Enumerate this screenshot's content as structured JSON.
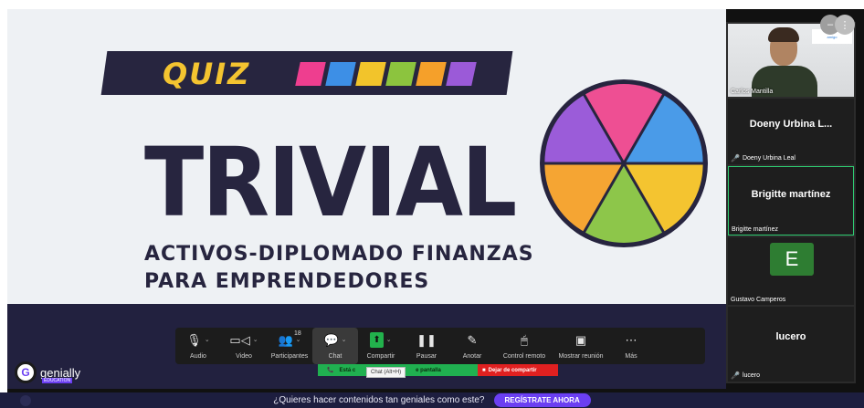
{
  "slide": {
    "quiz": "QUIZ",
    "trivial": "TRIVIAL",
    "subtitle_line1": "ACTIVOS-DIPLOMADO FINANZAS",
    "subtitle_line2": "PARA EMPRENDEDORES",
    "swatch_colors": [
      "#ee3e8f",
      "#3d8fe6",
      "#f2c42b",
      "#8cc43e",
      "#f5a02a",
      "#9b5ad8"
    ],
    "wheel_colors": [
      "#ee4f93",
      "#4a9be8",
      "#f4c430",
      "#8dc64a",
      "#f5a533",
      "#9b5cd9"
    ],
    "brand": "genially",
    "brand_sub": "EDUCATION"
  },
  "toolbar": {
    "items": [
      {
        "label": "Audio",
        "icon": "microphone-icon",
        "glyph": "🎙",
        "caret": true
      },
      {
        "label": "Video",
        "icon": "video-camera-icon",
        "glyph": "▭◁",
        "caret": true
      },
      {
        "label": "Participantes",
        "icon": "participants-icon",
        "glyph": "👥",
        "caret": true,
        "badge": "18"
      },
      {
        "label": "Chat",
        "icon": "chat-icon",
        "glyph": "💬",
        "caret": true,
        "active": true
      },
      {
        "label": "Compartir",
        "icon": "share-screen-icon",
        "glyph": "⬆",
        "caret": true
      },
      {
        "label": "Pausar",
        "icon": "pause-icon",
        "glyph": "❚❚",
        "caret": false
      },
      {
        "label": "Anotar",
        "icon": "annotate-pen-icon",
        "glyph": "✎",
        "caret": false
      },
      {
        "label": "Control remoto",
        "icon": "remote-control-mouse-icon",
        "glyph": "🖱",
        "caret": false
      },
      {
        "label": "Mostrar reunión",
        "icon": "show-meeting-icon",
        "glyph": "▣",
        "caret": false
      },
      {
        "label": "Más",
        "icon": "more-icon",
        "glyph": "⋯",
        "caret": false
      }
    ],
    "chat_tooltip": "Chat (Alt+H)",
    "share_status_left": "Está c",
    "share_status_right": "e pantalla",
    "stop_share": "Dejar de compartir"
  },
  "gallery": {
    "camera_name": "Carlos Mantilla",
    "poster_text": "amigo",
    "tiles": [
      {
        "big": "Doeny Urbina L...",
        "name": "Doeny Urbina Leal",
        "muted": true
      },
      {
        "big": "Brigitte martínez",
        "name": "Brigitte martínez",
        "muted": false
      },
      {
        "avatar": "E",
        "name": "Gustavo Camperos",
        "muted": false
      },
      {
        "big": "lucero",
        "name": "lucero",
        "muted": true
      }
    ]
  },
  "promo": {
    "text": "¿Quieres hacer contenidos tan geniales como este?",
    "button": "REGÍSTRATE AHORA"
  }
}
